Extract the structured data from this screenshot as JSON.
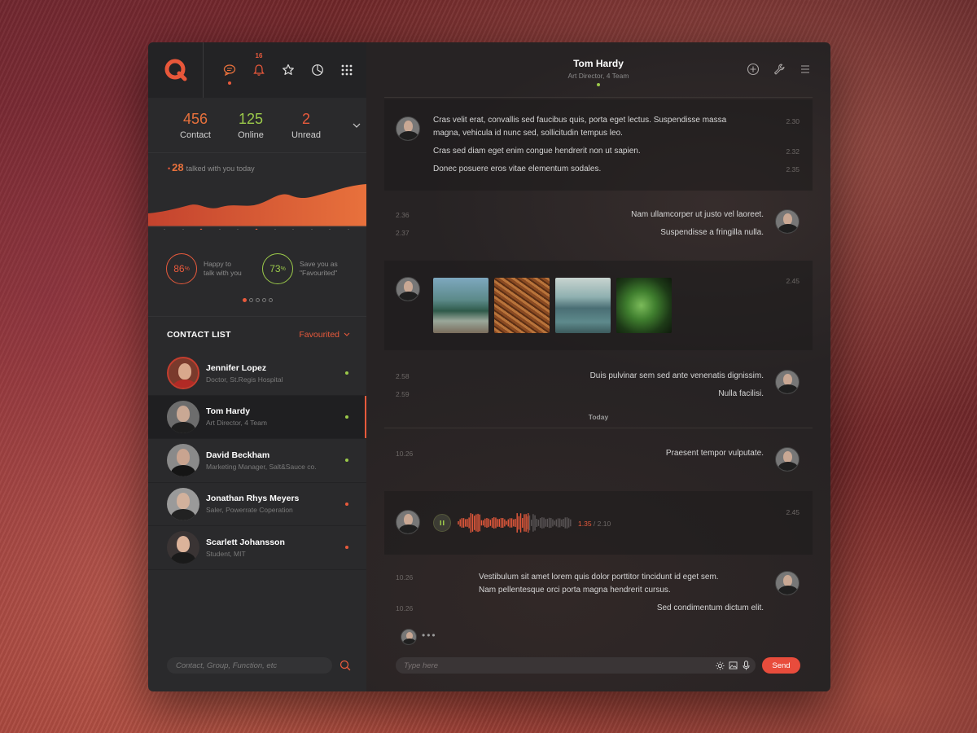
{
  "colors": {
    "accent": "#e85a3c",
    "green": "#9bc94a",
    "orange": "#e8713c"
  },
  "nav": {
    "notification_badge": "16"
  },
  "stats": [
    {
      "value": "456",
      "label": "Contact",
      "color": "#e8713c"
    },
    {
      "value": "125",
      "label": "Online",
      "color": "#9bc94a"
    },
    {
      "value": "2",
      "label": "Unread",
      "color": "#e85a3c"
    }
  ],
  "talked": {
    "count": "28",
    "text": "talked with you today"
  },
  "rings": [
    {
      "value": "86",
      "unit": "%",
      "text_line1": "Happy to",
      "text_line2": "talk with you",
      "color": "#e85a3c"
    },
    {
      "value": "73",
      "unit": "%",
      "text_line1": "Save you as",
      "text_line2": "\"Favourited\"",
      "color": "#9bc94a"
    }
  ],
  "contact_list": {
    "title": "CONTACT LIST",
    "filter": "Favourited",
    "contacts": [
      {
        "name": "Jennifer Lopez",
        "subtitle": "Doctor, St.Regis Hospital",
        "status_color": "#9bc94a"
      },
      {
        "name": "Tom Hardy",
        "subtitle": "Art Director, 4 Team",
        "status_color": "#9bc94a"
      },
      {
        "name": "David Beckham",
        "subtitle": "Marketing Manager, Salt&Sauce co.",
        "status_color": "#9bc94a"
      },
      {
        "name": "Jonathan Rhys Meyers",
        "subtitle": "Saler, Powerrate Coperation",
        "status_color": "#e85a3c"
      },
      {
        "name": "Scarlett Johansson",
        "subtitle": "Student, MIT",
        "status_color": "#e85a3c"
      }
    ]
  },
  "search": {
    "placeholder": "Contact, Group, Function, etc"
  },
  "chat": {
    "name": "Tom Hardy",
    "role": "Art Director, 4 Team",
    "messages": {
      "m1_line1": "Cras velit erat, convallis sed faucibus quis, porta eget lectus. Suspendisse massa",
      "m1_line2": "magna, vehicula id nunc sed, sollicitudin tempus leo.",
      "m1_time": "2.30",
      "m2": "Cras sed diam eget enim congue hendrerit non ut sapien.",
      "m2_time": "2.32",
      "m3": "Donec posuere eros vitae elementum sodales.",
      "m3_time": "2.35",
      "m4": "Nam ullamcorper ut justo vel laoreet.",
      "m4_time": "2.36",
      "m5": "Suspendisse a fringilla nulla.",
      "m5_time": "2.37",
      "images_time": "2.45",
      "m6": "Duis pulvinar sem sed ante venenatis dignissim.",
      "m6_time": "2.58",
      "m7": "Nulla facilisi.",
      "m7_time": "2.59",
      "today": "Today",
      "m8": "Praesent tempor vulputate.",
      "m8_time": "10.26",
      "audio_time": "2.45",
      "audio_current": "1.35",
      "audio_total": "/ 2.10",
      "m9_line1": "Vestibulum sit amet lorem quis dolor porttitor tincidunt id eget sem.",
      "m9_line2": "Nam pellentesque orci porta magna hendrerit cursus.",
      "m9_time": "10.26",
      "m10": "Sed condimentum dictum elit.",
      "m10_time": "10.26"
    },
    "audio_progress": 0.62
  },
  "composer": {
    "placeholder": "Type here",
    "send_label": "Send"
  }
}
